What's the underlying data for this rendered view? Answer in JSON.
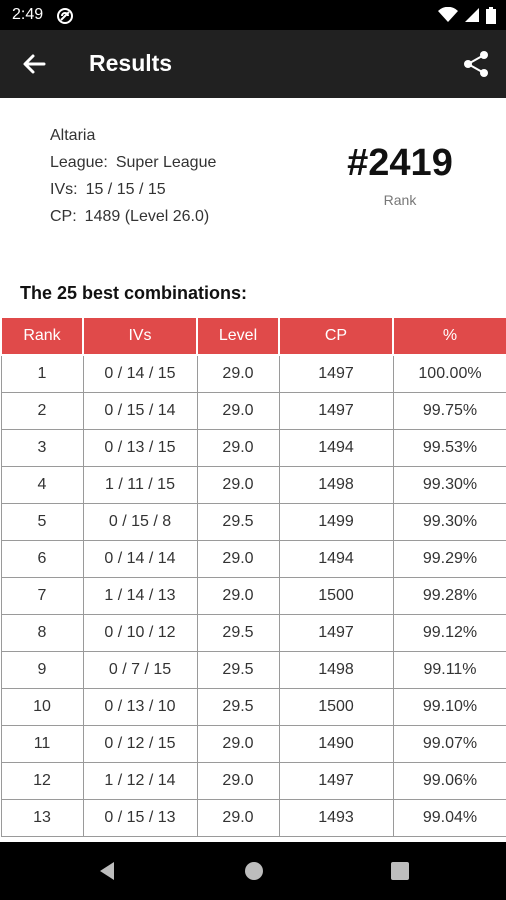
{
  "status_bar": {
    "time": "2:49"
  },
  "app_bar": {
    "title": "Results"
  },
  "summary": {
    "pokemon": "Altaria",
    "league_label": "League:",
    "league_value": "Super League",
    "ivs_label": "IVs:",
    "ivs_value": "15 / 15 / 15",
    "cp_label": "CP:",
    "cp_value": "1489 (Level 26.0)",
    "rank_value": "#2419",
    "rank_caption": "Rank"
  },
  "section_title": "The 25 best combinations:",
  "table": {
    "headers": [
      "Rank",
      "IVs",
      "Level",
      "CP",
      "%"
    ],
    "rows": [
      [
        "1",
        "0 / 14 / 15",
        "29.0",
        "1497",
        "100.00%"
      ],
      [
        "2",
        "0 / 15 / 14",
        "29.0",
        "1497",
        "99.75%"
      ],
      [
        "3",
        "0 / 13 / 15",
        "29.0",
        "1494",
        "99.53%"
      ],
      [
        "4",
        "1 / 11 / 15",
        "29.0",
        "1498",
        "99.30%"
      ],
      [
        "5",
        "0 / 15 / 8",
        "29.5",
        "1499",
        "99.30%"
      ],
      [
        "6",
        "0 / 14 / 14",
        "29.0",
        "1494",
        "99.29%"
      ],
      [
        "7",
        "1 / 14 / 13",
        "29.0",
        "1500",
        "99.28%"
      ],
      [
        "8",
        "0 / 10 / 12",
        "29.5",
        "1497",
        "99.12%"
      ],
      [
        "9",
        "0 / 7 / 15",
        "29.5",
        "1498",
        "99.11%"
      ],
      [
        "10",
        "0 / 13 / 10",
        "29.5",
        "1500",
        "99.10%"
      ],
      [
        "11",
        "0 / 12 / 15",
        "29.0",
        "1490",
        "99.07%"
      ],
      [
        "12",
        "1 / 12 / 14",
        "29.0",
        "1497",
        "99.06%"
      ],
      [
        "13",
        "0 / 15 / 13",
        "29.0",
        "1493",
        "99.04%"
      ]
    ]
  },
  "colors": {
    "header_bg": "#e04a4a",
    "app_bar": "#212121"
  },
  "icons": [
    "back-arrow-icon",
    "share-icon",
    "wifi-icon",
    "signal-icon",
    "battery-icon",
    "nav-back-icon",
    "nav-home-icon",
    "nav-recents-icon"
  ]
}
